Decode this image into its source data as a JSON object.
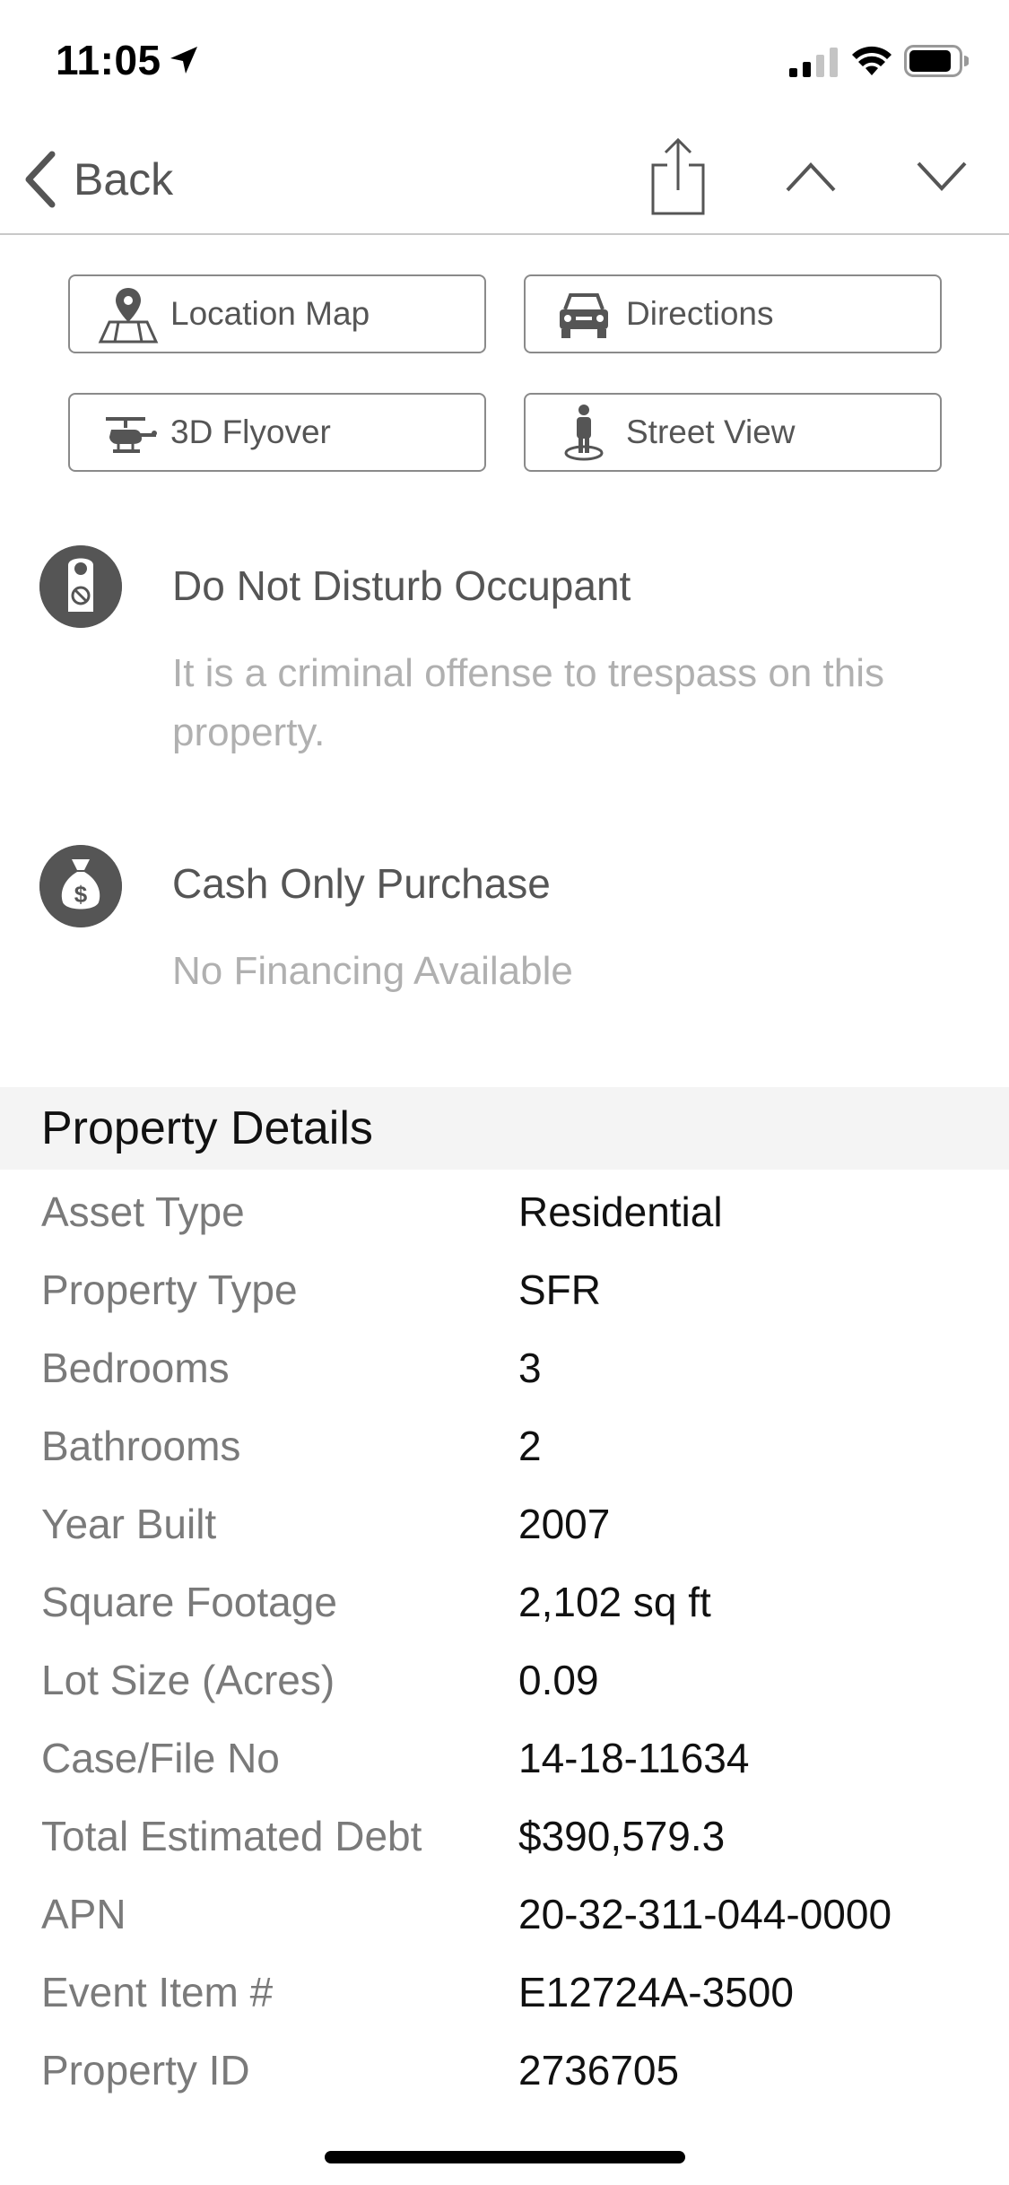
{
  "status_bar": {
    "time": "11:05"
  },
  "nav": {
    "back_label": "Back"
  },
  "actions": [
    {
      "label": "Location Map",
      "icon": "location-map-icon"
    },
    {
      "label": "Directions",
      "icon": "car-icon"
    },
    {
      "label": "3D Flyover",
      "icon": "helicopter-icon"
    },
    {
      "label": "Street View",
      "icon": "person-icon"
    }
  ],
  "notices": [
    {
      "title": "Do Not Disturb Occupant",
      "subtitle": "It is a criminal offense to trespass on this property.",
      "icon": "door-hanger-icon"
    },
    {
      "title": "Cash Only Purchase",
      "subtitle": "No Financing Available",
      "icon": "money-bag-icon"
    }
  ],
  "details": {
    "header": "Property Details",
    "rows": [
      {
        "label": "Asset Type",
        "value": "Residential"
      },
      {
        "label": "Property Type",
        "value": "SFR"
      },
      {
        "label": "Bedrooms",
        "value": "3"
      },
      {
        "label": "Bathrooms",
        "value": "2"
      },
      {
        "label": "Year Built",
        "value": "2007"
      },
      {
        "label": "Square Footage",
        "value": "2,102 sq ft"
      },
      {
        "label": "Lot Size (Acres)",
        "value": "0.09"
      },
      {
        "label": "Case/File No",
        "value": "14-18-11634"
      },
      {
        "label": "Total Estimated Debt",
        "value": "$390,579.3"
      },
      {
        "label": "APN",
        "value": "20-32-311-044-0000"
      },
      {
        "label": "Event Item #",
        "value": "E12724A-3500"
      },
      {
        "label": "Property ID",
        "value": "2736705"
      }
    ]
  }
}
